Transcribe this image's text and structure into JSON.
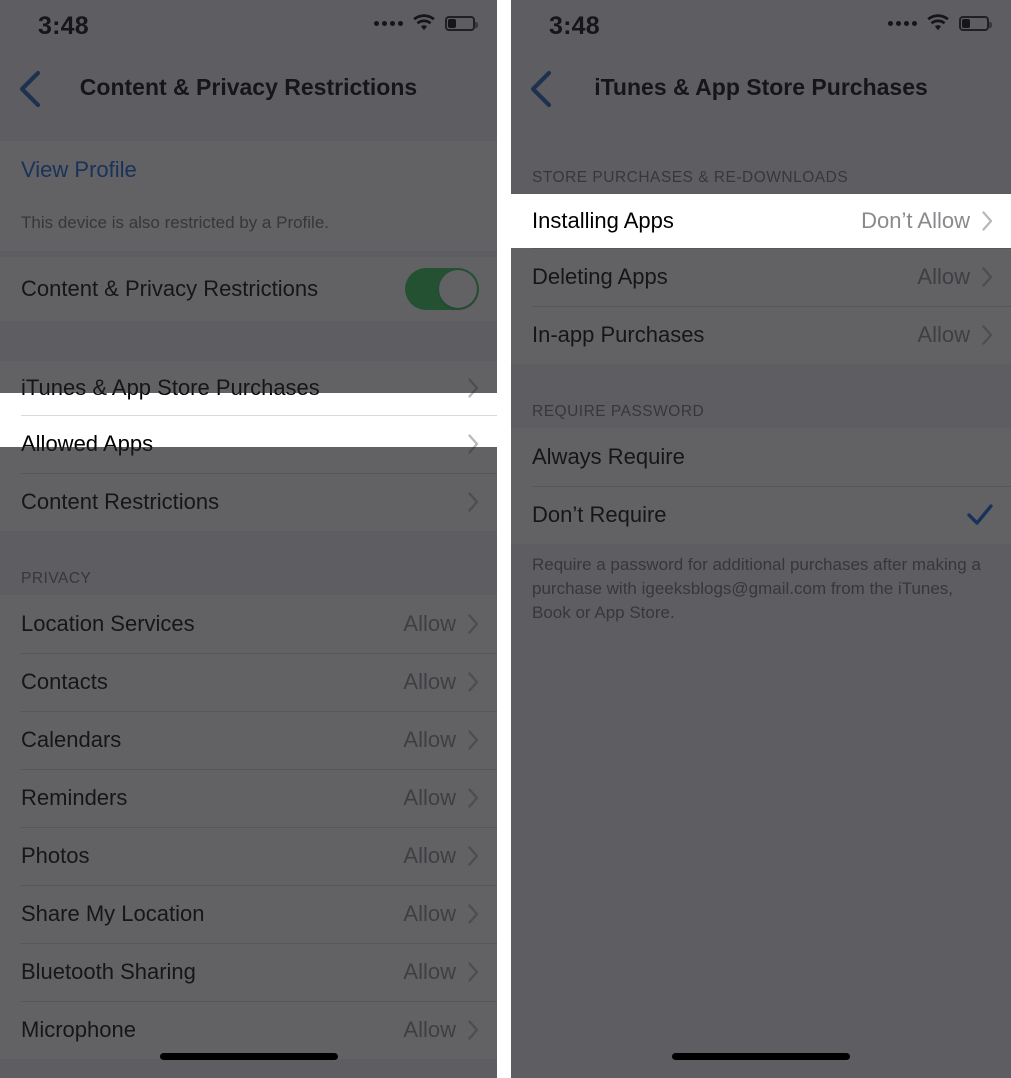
{
  "colors": {
    "accent_blue": "#0a60d6",
    "toggle_green": "#34c759",
    "checkmark_blue": "#1f4f8f",
    "list_background": "#f2f1f6",
    "dim_overlay": "rgba(32,32,36,0.70)"
  },
  "left_panel": {
    "status_bar": {
      "time": "3:48",
      "signal_icon": "signal-dots-icon",
      "wifi_icon": "wifi-icon",
      "battery_icon": "battery-icon",
      "battery_level": "30%"
    },
    "nav": {
      "back_icon": "chevron-left-icon",
      "title": "Content & Privacy Restrictions"
    },
    "profile_group": {
      "view_profile_label": "View Profile",
      "footnote": "This device is also restricted by a Profile."
    },
    "toggle_row": {
      "label": "Content & Privacy Restrictions",
      "state": "on",
      "toggle_icon": "toggle-switch-icon"
    },
    "main_group": [
      {
        "label": "iTunes & App Store Purchases",
        "value": "",
        "highlighted": true
      },
      {
        "label": "Allowed Apps",
        "value": "",
        "highlighted": false
      },
      {
        "label": "Content Restrictions",
        "value": "",
        "highlighted": false
      }
    ],
    "privacy_section": {
      "header": "PRIVACY",
      "rows": [
        {
          "label": "Location Services",
          "value": "Allow"
        },
        {
          "label": "Contacts",
          "value": "Allow"
        },
        {
          "label": "Calendars",
          "value": "Allow"
        },
        {
          "label": "Reminders",
          "value": "Allow"
        },
        {
          "label": "Photos",
          "value": "Allow"
        },
        {
          "label": "Share My Location",
          "value": "Allow"
        },
        {
          "label": "Bluetooth Sharing",
          "value": "Allow"
        },
        {
          "label": "Microphone",
          "value": "Allow"
        }
      ]
    },
    "home_indicator": "home-indicator"
  },
  "right_panel": {
    "status_bar": {
      "time": "3:48",
      "signal_icon": "signal-dots-icon",
      "wifi_icon": "wifi-icon",
      "battery_icon": "battery-icon",
      "battery_level": "30%"
    },
    "nav": {
      "back_icon": "chevron-left-icon",
      "title": "iTunes & App Store Purchases"
    },
    "store_section": {
      "header": "STORE PURCHASES & RE-DOWNLOADS",
      "rows": [
        {
          "label": "Installing Apps",
          "value": "Don’t Allow",
          "highlighted": true
        },
        {
          "label": "Deleting Apps",
          "value": "Allow",
          "highlighted": false
        },
        {
          "label": "In-app Purchases",
          "value": "Allow",
          "highlighted": false
        }
      ]
    },
    "password_section": {
      "header": "REQUIRE PASSWORD",
      "rows": [
        {
          "label": "Always Require",
          "checked": false
        },
        {
          "label": "Don’t Require",
          "checked": true
        }
      ],
      "footnote": "Require a password for additional purchases after making a purchase with igeeksblogs@gmail.com from the iTunes, Book or App Store."
    },
    "home_indicator": "home-indicator"
  }
}
